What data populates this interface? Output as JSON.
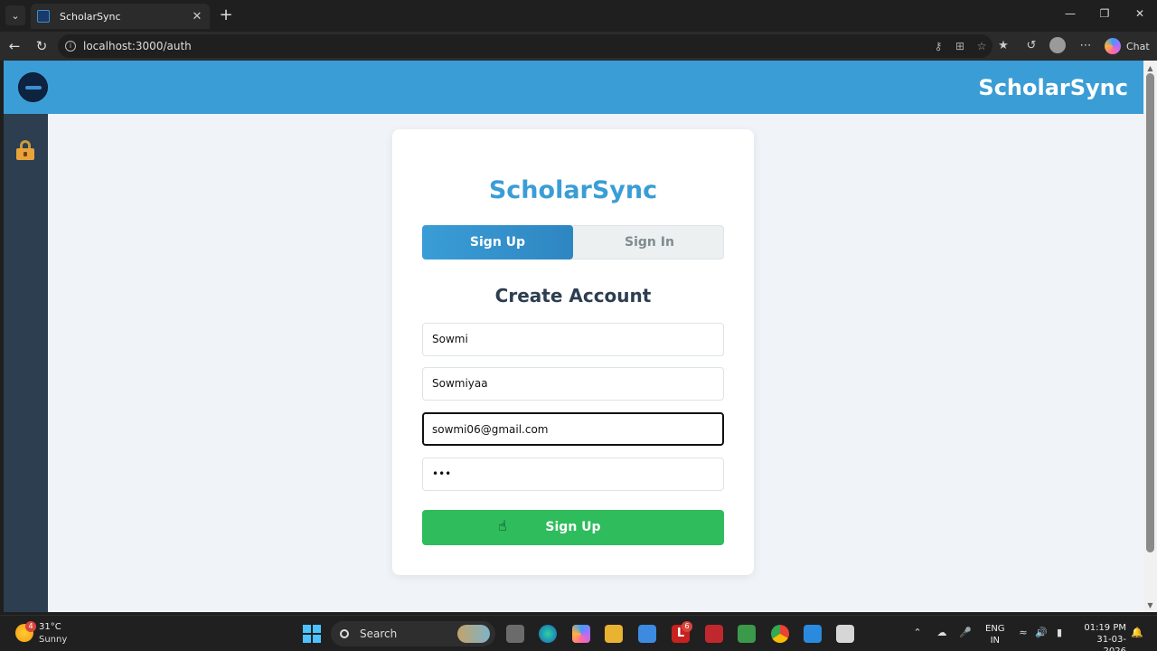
{
  "browser": {
    "tab_title": "ScholarSync",
    "url": "localhost:3000/auth",
    "chat_label": "Chat"
  },
  "header": {
    "title": "ScholarSync"
  },
  "auth": {
    "card_title": "ScholarSync",
    "tab_signup": "Sign Up",
    "tab_signin": "Sign In",
    "form_title": "Create Account",
    "fields": {
      "first": "Sowmi",
      "second": "Sowmiyaa",
      "email": "sowmi06@gmail.com",
      "password": "•••"
    },
    "submit_label": "Sign Up"
  },
  "taskbar": {
    "temp": "31°C",
    "condition": "Sunny",
    "weather_badge": "4",
    "search_label": "Search",
    "l_badge": "6",
    "lang_line1": "ENG",
    "lang_line2": "IN",
    "time": "01:19 PM",
    "date": "31-03-2026"
  },
  "colors": {
    "header_blue": "#3a9dd6",
    "sidebar": "#2c3e50",
    "submit_green": "#2ebc5c"
  }
}
